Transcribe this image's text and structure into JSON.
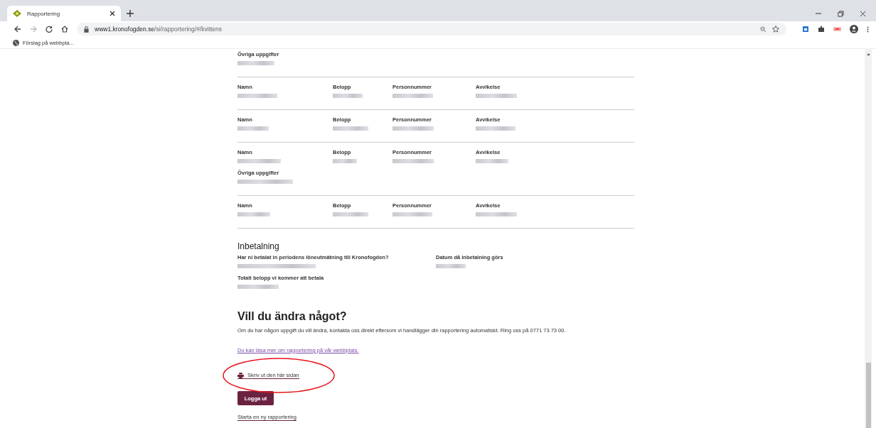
{
  "browser": {
    "tab_title": "Rapportering",
    "url_host": "www1.kronofogden.se",
    "url_path": "/si/rapportering/#/kvittens",
    "bookmark": "Förslag på webbpla..."
  },
  "top_note": {
    "label": "Övriga uppgifter"
  },
  "records": [
    {
      "fields": [
        "Namn",
        "Belopp",
        "Personnummer",
        "Avvikelse"
      ]
    },
    {
      "fields": [
        "Namn",
        "Belopp",
        "Personnummer",
        "Avvikelse"
      ]
    },
    {
      "fields": [
        "Namn",
        "Belopp",
        "Personnummer",
        "Avvikelse"
      ],
      "note_label": "Övriga uppgifter"
    },
    {
      "fields": [
        "Namn",
        "Belopp",
        "Personnummer",
        "Avvikelse"
      ]
    }
  ],
  "payment": {
    "heading": "Inbetalning",
    "fields": [
      "Har ni betalat in periodens löneutmätning till Kronofogden?",
      "Datum då inbetalning görs",
      "Totalt belopp vi kommer att betala"
    ]
  },
  "change": {
    "heading": "Vill du ändra något?",
    "text": "Om du har någon uppgift du vill ändra, kontakta oss direkt eftersom vi handlägger din rapportering automatiskt. Ring oss på 0771 73 73 00.",
    "read_more_link": "Du kan läsa mer om rapportering på vår webbplats.",
    "print_link": "Skriv ut den här sidan",
    "logout_button": "Logga ut",
    "new_report_link": "Starta en ny rapportering"
  }
}
